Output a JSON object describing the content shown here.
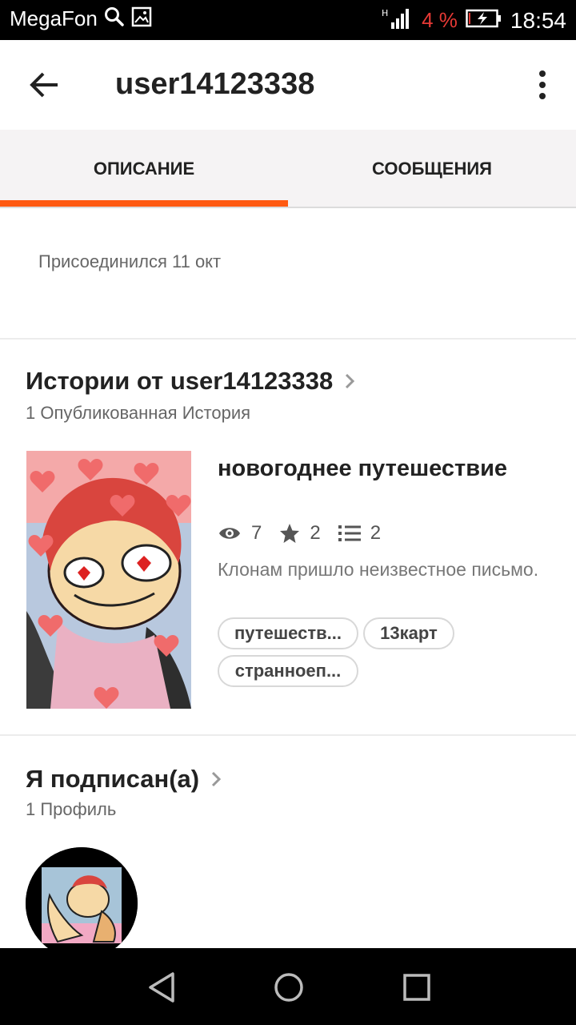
{
  "status_bar": {
    "carrier": "MegaFon",
    "battery_percent": "4 %",
    "time": "18:54",
    "icons": [
      "search-icon",
      "image-icon",
      "signal-icon",
      "battery-charging-icon"
    ]
  },
  "app_bar": {
    "title": "user14123338",
    "back_icon": "arrow-back-icon",
    "menu_icon": "more-vert-icon"
  },
  "tabs": [
    {
      "label": "ОПИСАНИЕ",
      "active": true
    },
    {
      "label": "СООБЩЕНИЯ",
      "active": false
    }
  ],
  "colors": {
    "accent": "#ff5a12",
    "battery_low": "#e53935"
  },
  "joined_text": "Присоединился 11 окт",
  "stories": {
    "title": "Истории от user14123338",
    "subtitle": "1 Опубликованная История",
    "items": [
      {
        "title": "новогоднее путешествие",
        "views": "7",
        "votes": "2",
        "parts": "2",
        "description": "Клонам пришло неизвестное письмо.",
        "tags": [
          "путешеств...",
          "13карт",
          "странноеп..."
        ]
      }
    ]
  },
  "following": {
    "title": "Я подписан(а)",
    "subtitle": "1 Профиль"
  },
  "nav_bar": {
    "icons": [
      "nav-back-icon",
      "nav-home-icon",
      "nav-recents-icon"
    ]
  }
}
